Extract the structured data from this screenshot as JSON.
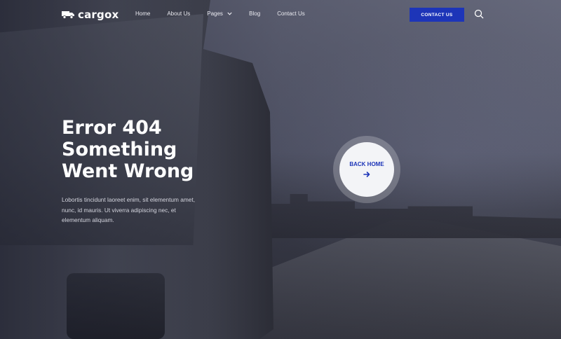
{
  "brand": {
    "name": "cargox",
    "icon": "truck-icon"
  },
  "nav": {
    "items": [
      {
        "label": "Home"
      },
      {
        "label": "About Us"
      },
      {
        "label": "Pages",
        "has_dropdown": true
      },
      {
        "label": "Blog"
      },
      {
        "label": "Contact Us"
      }
    ]
  },
  "header": {
    "contact_button": "CONTACT US",
    "search_icon": "search-icon"
  },
  "hero": {
    "headline_lines": [
      "Error 404",
      "Something",
      "Went Wrong"
    ],
    "description": "Lobortis tincidunt laoreet enim, sit elementum amet, nunc, id mauris. Ut viverra adipiscing nec, et elementum aliquam.",
    "back_home_label": "BACK HOME",
    "back_home_icon": "arrow-right-icon"
  },
  "colors": {
    "accent": "#1d35b8",
    "text": "#ffffff",
    "button_circle": "#f3f4f7"
  }
}
